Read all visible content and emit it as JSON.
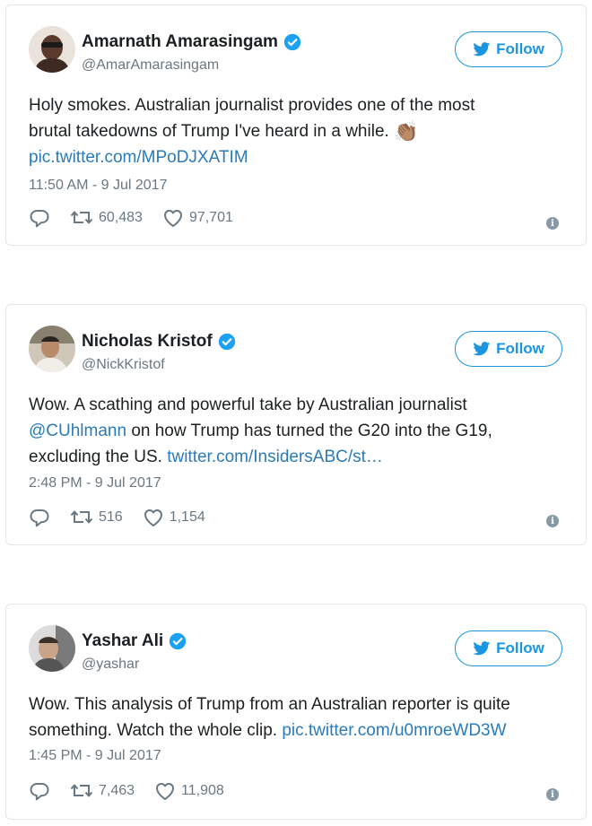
{
  "tweets": [
    {
      "name": "Amarnath Amarasingam",
      "handle": "@AmarAmarasingam",
      "follow_label": "Follow",
      "text_lines": [
        "Holy smokes. Australian journalist provides one of the most",
        "brutal takedowns of Trump I've heard in a while."
      ],
      "emoji": "👏🏽",
      "link": "pic.twitter.com/MPoDJXATIM",
      "timestamp": "11:50 AM - 9 Jul 2017",
      "retweets": "60,483",
      "likes": "97,701"
    },
    {
      "name": "Nicholas Kristof",
      "handle": "@NickKristof",
      "follow_label": "Follow",
      "text_line1": "Wow. A scathing and powerful take by Australian journalist",
      "mention": "@CUhlmann",
      "text_line2_rest": " on how Trump has turned the G20 into the G19,",
      "text_line3": "excluding the US. ",
      "link": "twitter.com/InsidersABC/st…",
      "timestamp": "2:48 PM - 9 Jul 2017",
      "retweets": "516",
      "likes": "1,154"
    },
    {
      "name": "Yashar Ali",
      "handle": "@yashar",
      "follow_label": "Follow",
      "text_line1": "Wow. This analysis of Trump from an Australian reporter is quite",
      "text_line2": "something. Watch the whole clip. ",
      "link": "pic.twitter.com/u0mroeWD3W",
      "timestamp": "1:45 PM - 9 Jul 2017",
      "retweets": "7,463",
      "likes": "11,908"
    }
  ],
  "colors": {
    "accent": "#1b95e0",
    "link": "#2b7bb9",
    "muted": "#697882",
    "border": "#e1e8ed"
  },
  "icons": [
    "verified-icon",
    "twitter-bird-icon",
    "reply-icon",
    "retweet-icon",
    "heart-icon",
    "info-icon"
  ]
}
